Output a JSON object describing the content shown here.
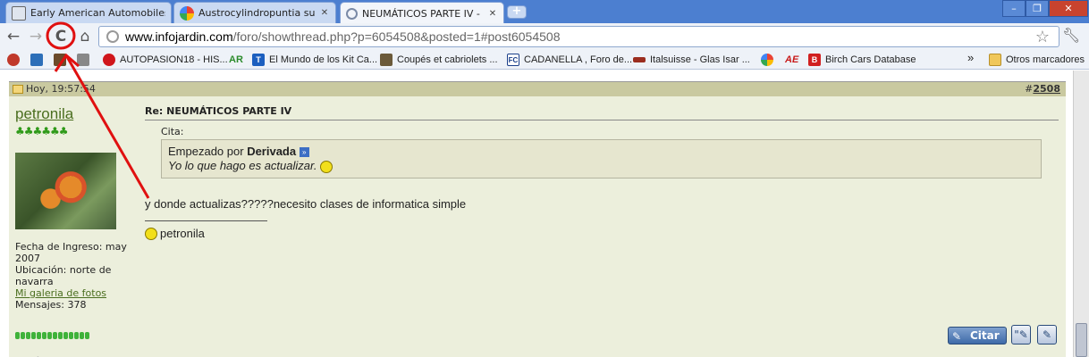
{
  "browser": {
    "tabs": [
      {
        "title": "Early American Automobiles Pa",
        "active": false
      },
      {
        "title": "Austrocylindropuntia subulata",
        "active": false
      },
      {
        "title": "NEUMÁTICOS PARTE IV - Pági",
        "active": true
      }
    ],
    "new_tab_label": "+",
    "window_buttons": {
      "minimize": "–",
      "maximize": "❐",
      "close": "✕"
    },
    "nav": {
      "back": "←",
      "forward": "→",
      "reload": "C",
      "home": "⌂"
    },
    "address": {
      "host": "www.infojardin.com",
      "path": "/foro/showthread.php?p=6054508&posted=1#post6054508"
    },
    "bookmarks": [
      {
        "label": "",
        "color": "#c0392b"
      },
      {
        "label": "",
        "color": "#2d6fb8"
      },
      {
        "label": "",
        "color": "#6b4a2a"
      },
      {
        "label": "AUTOPASION18 - HIS...",
        "color": "#d0161c"
      },
      {
        "label": "AR",
        "color": "#2c8b2c"
      },
      {
        "label": "El Mundo de los Kit Ca...",
        "color": "#1c5fbf"
      },
      {
        "label": "Coupés et cabriolets ...",
        "color": "#6b5a3a"
      },
      {
        "label": "CADANELLA , Foro de...",
        "color": "#1a3f8a"
      },
      {
        "label": "Italsuisse - Glas Isar ...",
        "color": "#9b2d1f"
      },
      {
        "label": "",
        "color": "#3b77d8"
      },
      {
        "label": "AE",
        "color": "#c81a1a"
      },
      {
        "label": "Birch Cars Database",
        "color": "#d12020"
      }
    ],
    "bookmarks_more": "»",
    "other_bookmarks": "Otros marcadores"
  },
  "post": {
    "date": "Hoy, 19:57:54",
    "number_prefix": "#",
    "number": "2508",
    "username": "petronila",
    "clovers": "♣♣♣♣♣♣",
    "join_date": "Fecha de Ingreso: may 2007",
    "location": "Ubicación: norte de navarra",
    "gallery_link": "Mi galeria de fotos",
    "messages": "Mensajes: 378",
    "title": "Re: NEUMÁTICOS PARTE IV",
    "quote_label": "Cita:",
    "quote_started_by": "Empezado por",
    "quote_author": "Derivada",
    "quote_text": "Yo lo que hago es actualizar.",
    "message": "y donde actualizas?????necesito clases de informatica simple",
    "signature": "petronila",
    "quote_button": "Citar"
  },
  "colors": {
    "titlebar": "#4c7fd0",
    "post_header": "#c9c9a0",
    "post_background": "#ecefdc",
    "username": "#4a6e1f",
    "annotation": "#e01010"
  }
}
